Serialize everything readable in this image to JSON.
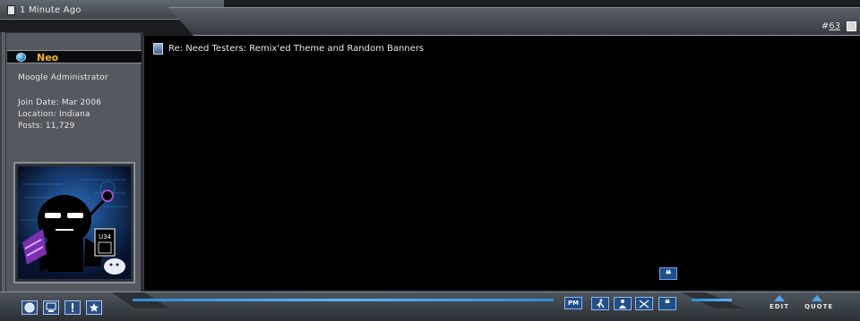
{
  "header": {
    "timestamp": "1 Minute Ago",
    "post_number_prefix": "#",
    "post_number": "63"
  },
  "user": {
    "name": "Neo",
    "title": "Moogle Administrator",
    "join_date": "Join Date: Mar 2006",
    "location": "Location: Indiana",
    "posts": "Posts: 11,729",
    "avatar_text": "U34"
  },
  "post": {
    "title": "Re: Need Testers: Remix'ed Theme and Random Banners",
    "quote_mark": "❝"
  },
  "footer": {
    "left_icons": [
      "profile-icon",
      "computer-icon",
      "info-icon",
      "star-icon"
    ],
    "right_icons": [
      "pm-icon",
      "user-action-icon",
      "user-info-icon",
      "search-icon",
      "multi-quote-icon"
    ],
    "pm_label": "PM",
    "edit_label": "EDIT",
    "quote_label": "QUOTE"
  },
  "colors": {
    "username": "#f2b51e",
    "accent": "#2f8ed6",
    "content_bg": "#000000"
  }
}
